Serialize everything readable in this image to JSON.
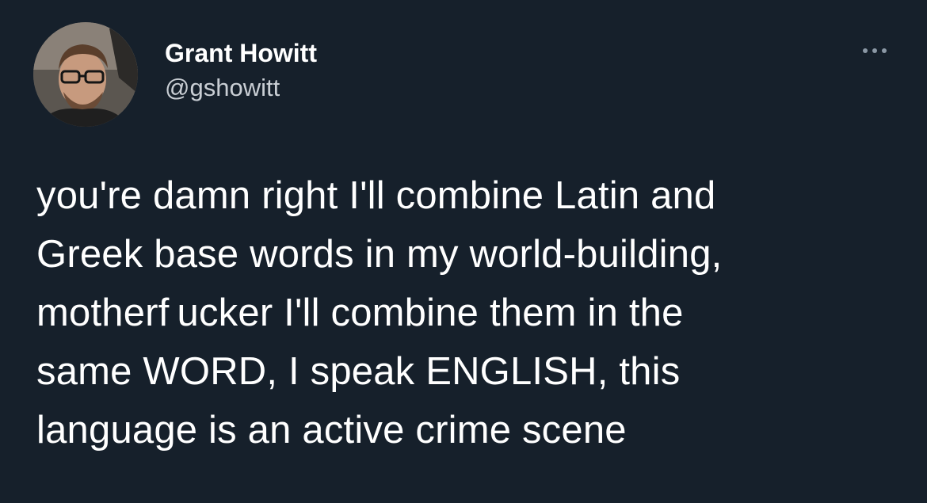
{
  "tweet": {
    "author": {
      "display_name": "Grant Howitt",
      "handle": "@gshowitt",
      "avatar_icon": "profile-photo"
    },
    "more_icon": "more-horizontal-icon",
    "lines": [
      "you're damn right I'll combine Latin and",
      "Greek base words in my world-building,",
      "motherf ucker I'll combine them in the",
      "same WORD, I speak ENGLISH, this",
      "language is an active crime scene"
    ],
    "colors": {
      "background": "#16202b",
      "text": "#ffffff",
      "secondary_text": "#c9ced4",
      "icon": "#8b98a5"
    }
  }
}
